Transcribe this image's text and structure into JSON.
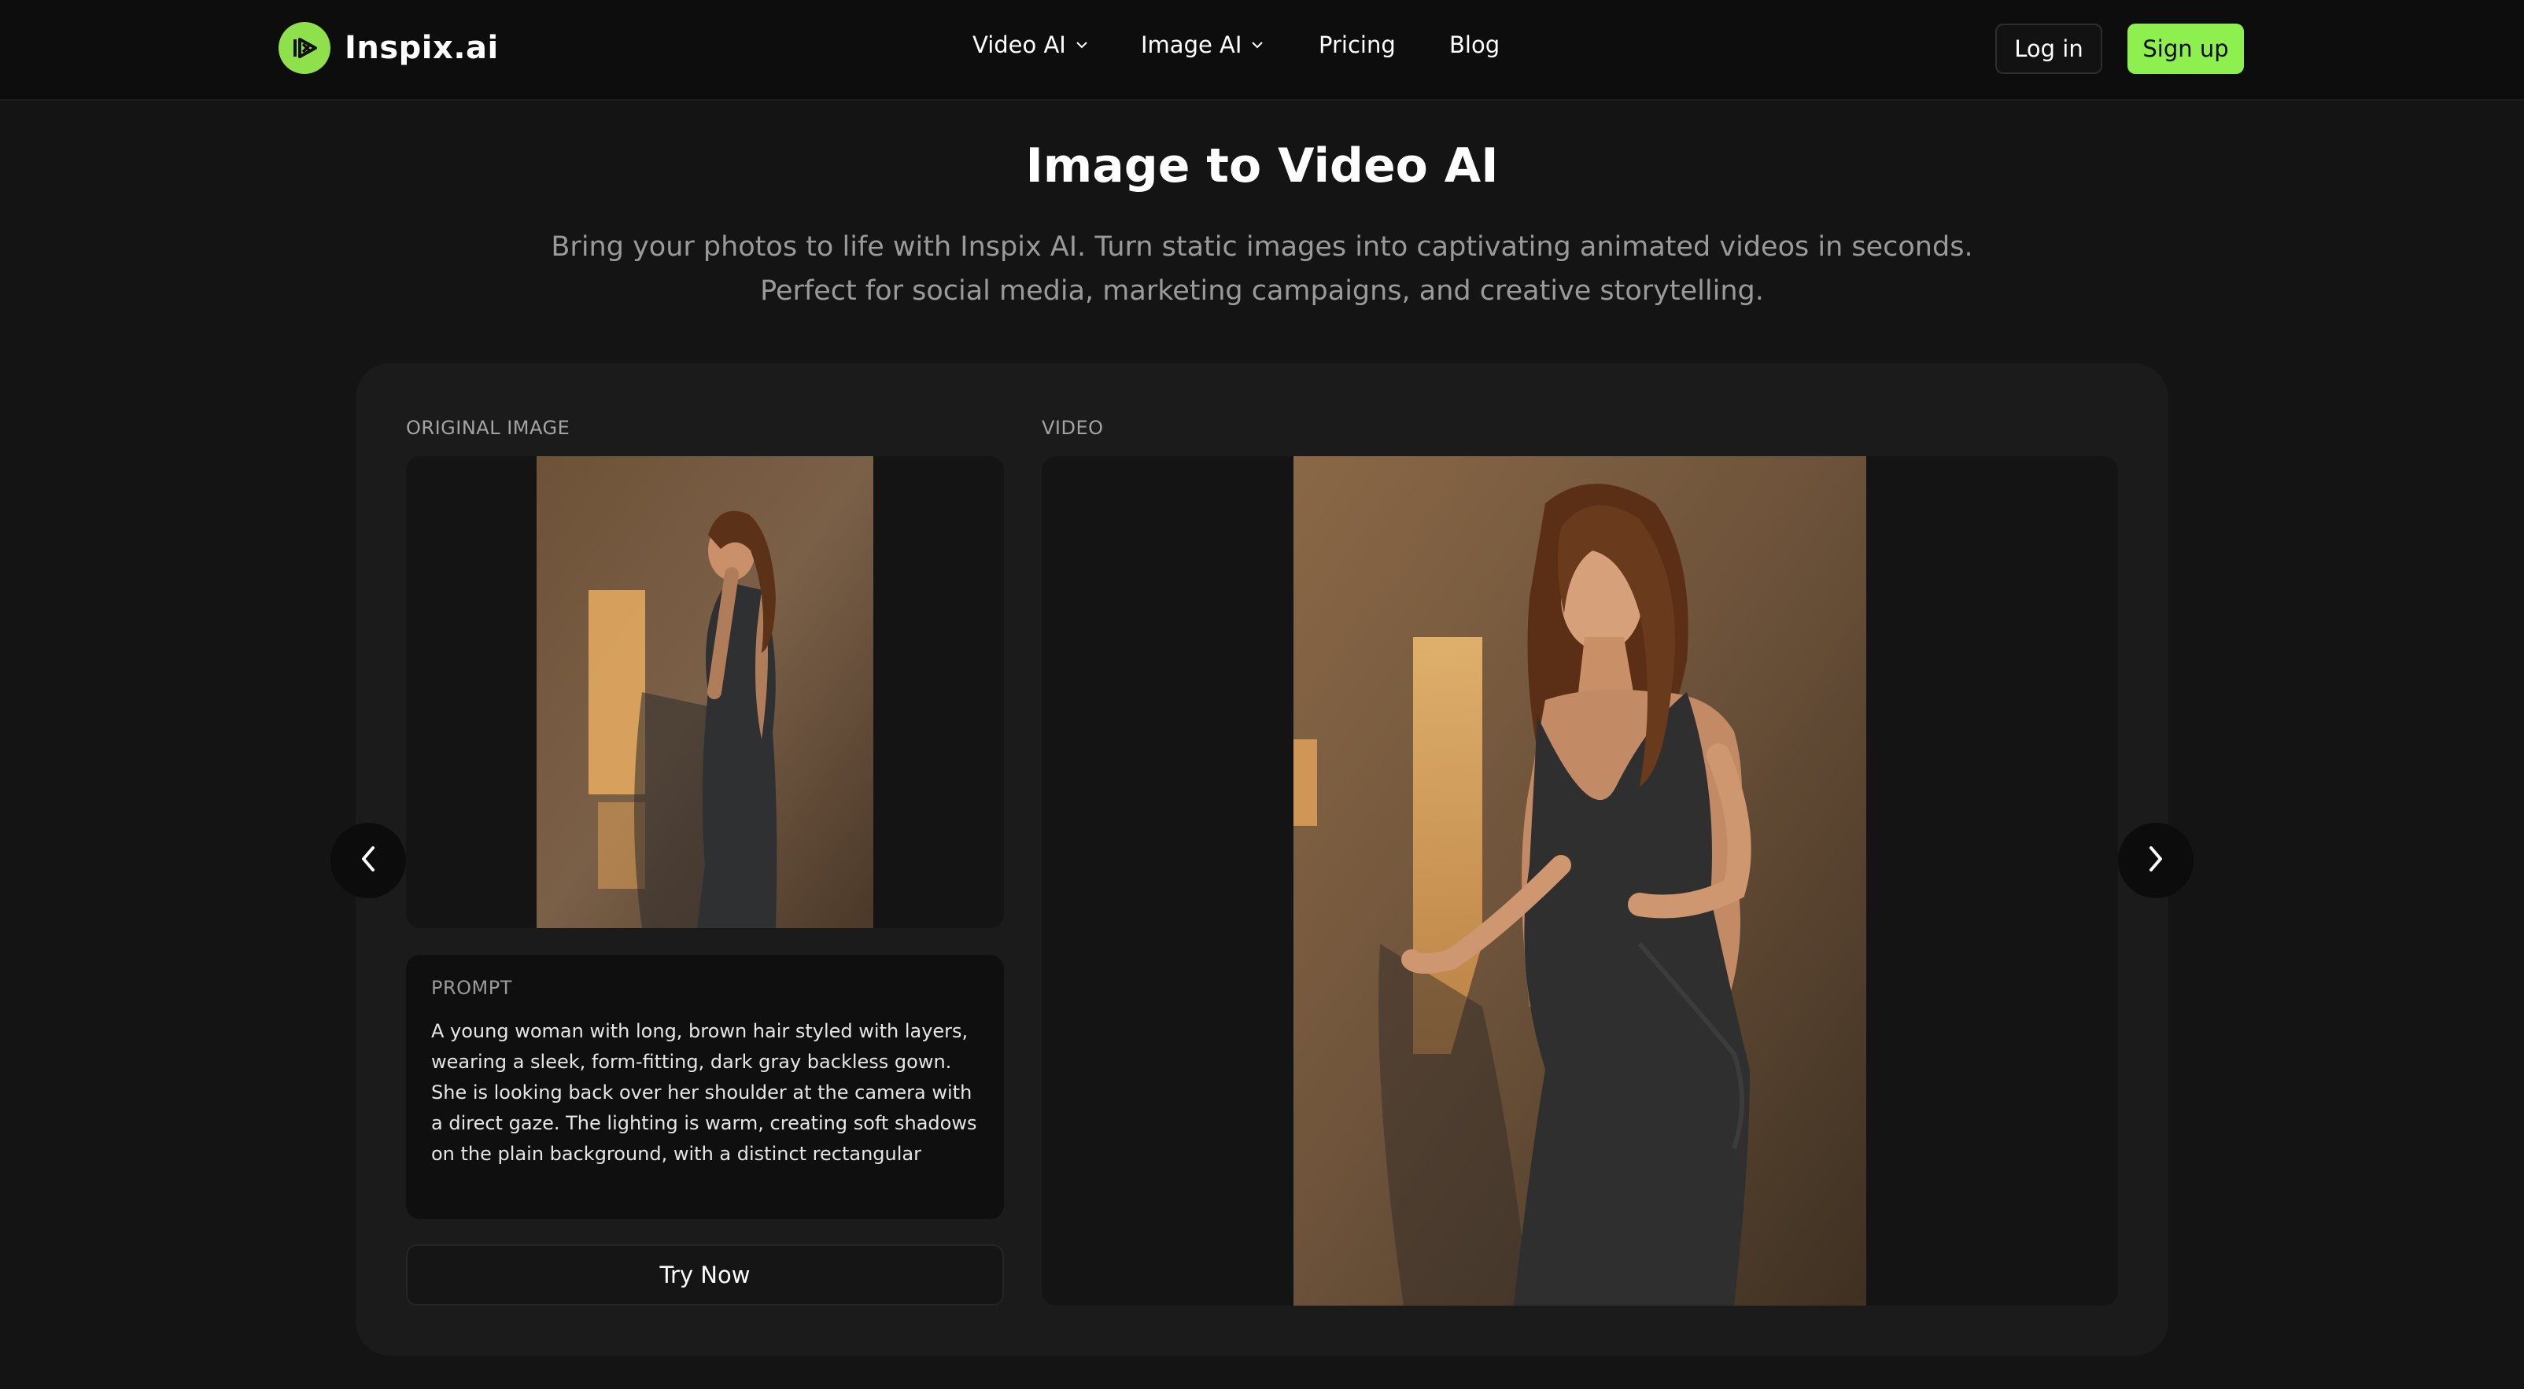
{
  "brand": {
    "name": "Inspix.ai",
    "accent": "#8ef04f",
    "logo_icon": "play-logo-icon"
  },
  "nav": {
    "items": [
      {
        "label": "Video AI",
        "has_dropdown": true
      },
      {
        "label": "Image AI",
        "has_dropdown": true
      },
      {
        "label": "Pricing",
        "has_dropdown": false
      },
      {
        "label": "Blog",
        "has_dropdown": false
      }
    ],
    "login_label": "Log in",
    "signup_label": "Sign up"
  },
  "hero": {
    "title": "Image to Video AI",
    "subtitle_line1": "Bring your photos to life with Inspix AI. Turn static images into captivating animated videos in seconds.",
    "subtitle_line2": "Perfect for social media, marketing campaigns, and creative storytelling."
  },
  "showcase": {
    "original_label": "ORIGINAL IMAGE",
    "video_label": "VIDEO",
    "prompt_label": "PROMPT",
    "prompt_text": "A young woman with long, brown hair styled with layers, wearing a sleek, form-fitting, dark gray backless gown. She is looking back over her shoulder at the camera with a direct gaze. The lighting is warm, creating soft shadows on the plain background, with a distinct rectangular shadow from a",
    "try_label": "Try Now",
    "prev_icon": "chevron-left-icon",
    "next_icon": "chevron-right-icon"
  }
}
